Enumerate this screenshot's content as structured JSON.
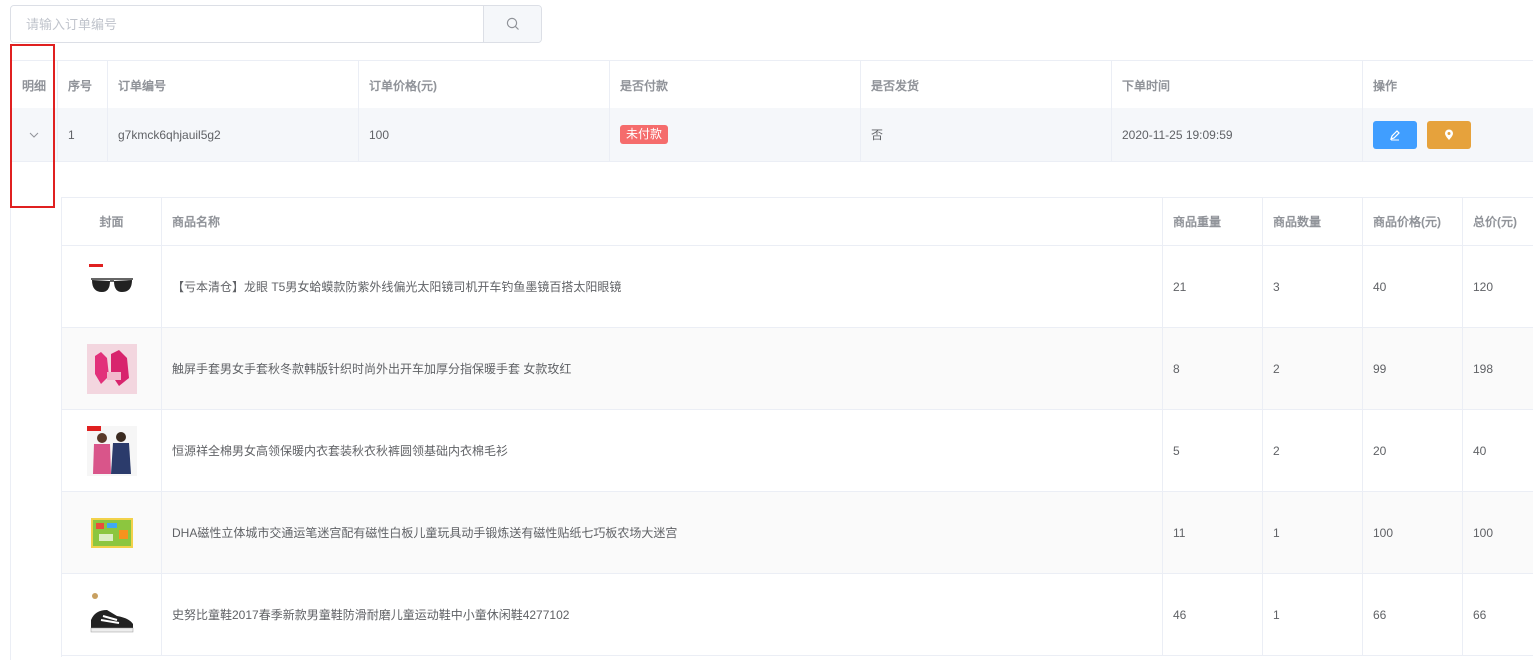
{
  "search": {
    "placeholder": "请输入订单编号",
    "value": ""
  },
  "table": {
    "columns": [
      "明细",
      "序号",
      "订单编号",
      "订单价格(元)",
      "是否付款",
      "是否发货",
      "下单时间",
      "操作"
    ],
    "row": {
      "index": "1",
      "order_no": "g7kmck6qhjauil5g2",
      "price": "100",
      "paid": "未付款",
      "shipped": "否",
      "time": "2020-11-25 19:09:59"
    },
    "actions": [
      {
        "name": "edit",
        "icon": "edit-icon",
        "color": "#409eff"
      },
      {
        "name": "location",
        "icon": "location-icon",
        "color": "#e6a23c"
      }
    ]
  },
  "detail": {
    "columns": [
      "封面",
      "商品名称",
      "商品重量",
      "商品数量",
      "商品价格(元)",
      "总价(元)"
    ],
    "rows": [
      {
        "cover": "sunglasses-image",
        "name": "【亏本清仓】龙眼 T5男女蛤蟆款防紫外线偏光太阳镜司机开车钓鱼墨镜百搭太阳眼镜",
        "weight": "21",
        "qty": "3",
        "price": "40",
        "total": "120"
      },
      {
        "cover": "gloves-image",
        "name": "触屏手套男女手套秋冬款韩版针织时尚外出开车加厚分指保暖手套 女款玫红",
        "weight": "8",
        "qty": "2",
        "price": "99",
        "total": "198"
      },
      {
        "cover": "underwear-image",
        "name": "恒源祥全棉男女高领保暖内衣套装秋衣秋裤圆领基础内衣棉毛衫",
        "weight": "5",
        "qty": "2",
        "price": "20",
        "total": "40"
      },
      {
        "cover": "maze-toy-image",
        "name": "DHA磁性立体城市交通运笔迷宫配有磁性白板儿童玩具动手锻炼送有磁性贴纸七巧板农场大迷宫",
        "weight": "11",
        "qty": "1",
        "price": "100",
        "total": "100"
      },
      {
        "cover": "shoes-image",
        "name": "史努比童鞋2017春季新款男童鞋防滑耐磨儿童运动鞋中小童休闲鞋4277102",
        "weight": "46",
        "qty": "1",
        "price": "66",
        "total": "66"
      }
    ]
  },
  "colors": {
    "primary": "#409eff",
    "warning": "#e6a23c",
    "danger": "#f56c6c",
    "highlight_frame": "#e02020"
  }
}
